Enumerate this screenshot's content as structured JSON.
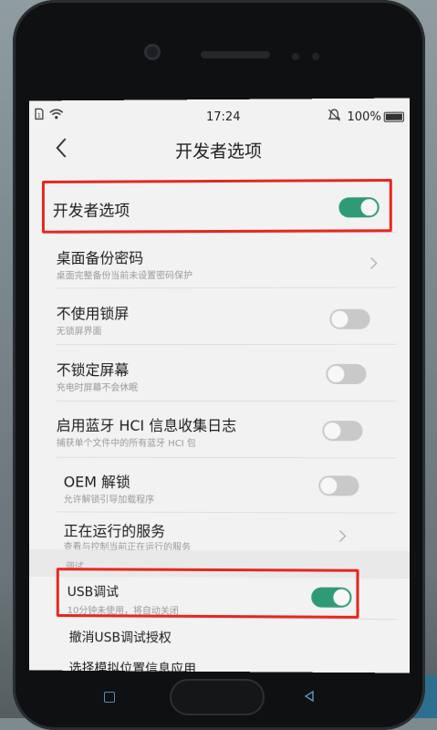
{
  "status_bar": {
    "time": "17:24",
    "battery": "100%",
    "sim_icon": "sim-icon",
    "wifi_icon": "wifi-icon",
    "mute_icon": "mute-icon"
  },
  "header": {
    "title": "开发者选项",
    "back_icon": "back-arrow-icon"
  },
  "master_toggle": {
    "label": "开发者选项",
    "on": true
  },
  "items": [
    {
      "title": "桌面备份密码",
      "subtitle": "桌面完整备份当前未设置密码保护",
      "control": "chevron"
    },
    {
      "title": "不使用锁屏",
      "subtitle": "无锁屏界面",
      "control": "toggle",
      "on": false
    },
    {
      "title": "不锁定屏幕",
      "subtitle": "充电时屏幕不会休眠",
      "control": "toggle",
      "on": false
    },
    {
      "title": "启用蓝牙 HCI 信息收集日志",
      "subtitle": "捕获单个文件中的所有蓝牙 HCI 包",
      "control": "toggle",
      "on": false
    },
    {
      "title": "OEM 解锁",
      "subtitle": "允许解锁引导加载程序",
      "control": "toggle",
      "on": false
    },
    {
      "title": "正在运行的服务",
      "subtitle": "查看与控制当前正在运行的服务",
      "control": "chevron"
    }
  ],
  "section": {
    "label": "调试"
  },
  "debug_items": [
    {
      "title": "USB调试",
      "subtitle": "10分钟未使用，将自动关闭",
      "control": "toggle",
      "on": true
    },
    {
      "title": "撤消USB调试授权"
    },
    {
      "title": "选择模拟位置信息应用"
    }
  ],
  "colors": {
    "toggle_on": "#2f9b76",
    "toggle_off": "#c9c9c9",
    "highlight": "#e8261e"
  }
}
